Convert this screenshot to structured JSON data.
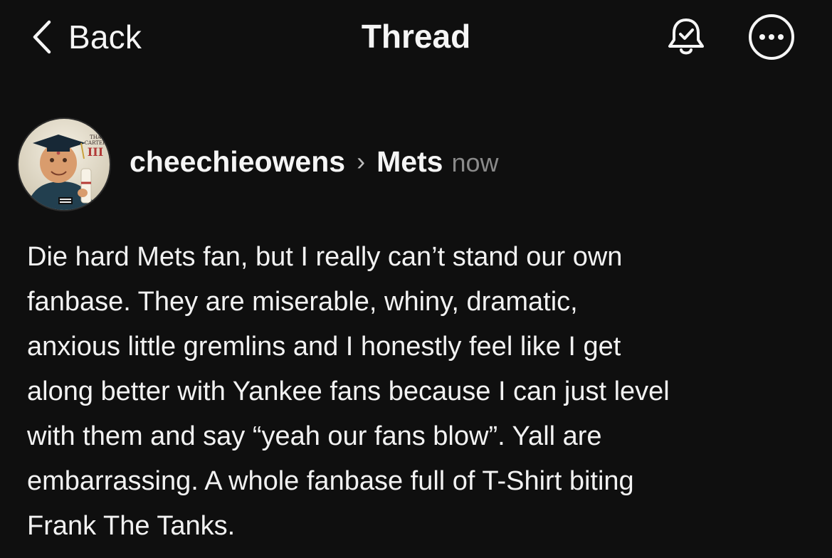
{
  "header": {
    "back_label": "Back",
    "title": "Thread",
    "icons": [
      "chevron-left-icon",
      "bell-check-icon",
      "more-options-icon"
    ]
  },
  "post": {
    "username": "cheechieowens",
    "separator": "›",
    "community": "Mets",
    "timestamp": "now",
    "avatar_text": {
      "top": "THA",
      "middle": "CARTER",
      "numeral": "III"
    },
    "lines": [
      "Die hard Mets fan, but I really can’t stand our own",
      "fanbase. They are miserable, whiny, dramatic,",
      "anxious little gremlins and I honestly feel like I get",
      "along better with Yankee fans because I can just level",
      "with them and say “yeah our fans blow”. Yall are",
      "embarrassing. A whole fanbase full of T-Shirt biting",
      "Frank The Tanks."
    ]
  },
  "colors": {
    "background": "#0f0f0f",
    "text": "#f2f2f2",
    "muted": "#8a8a8a"
  }
}
